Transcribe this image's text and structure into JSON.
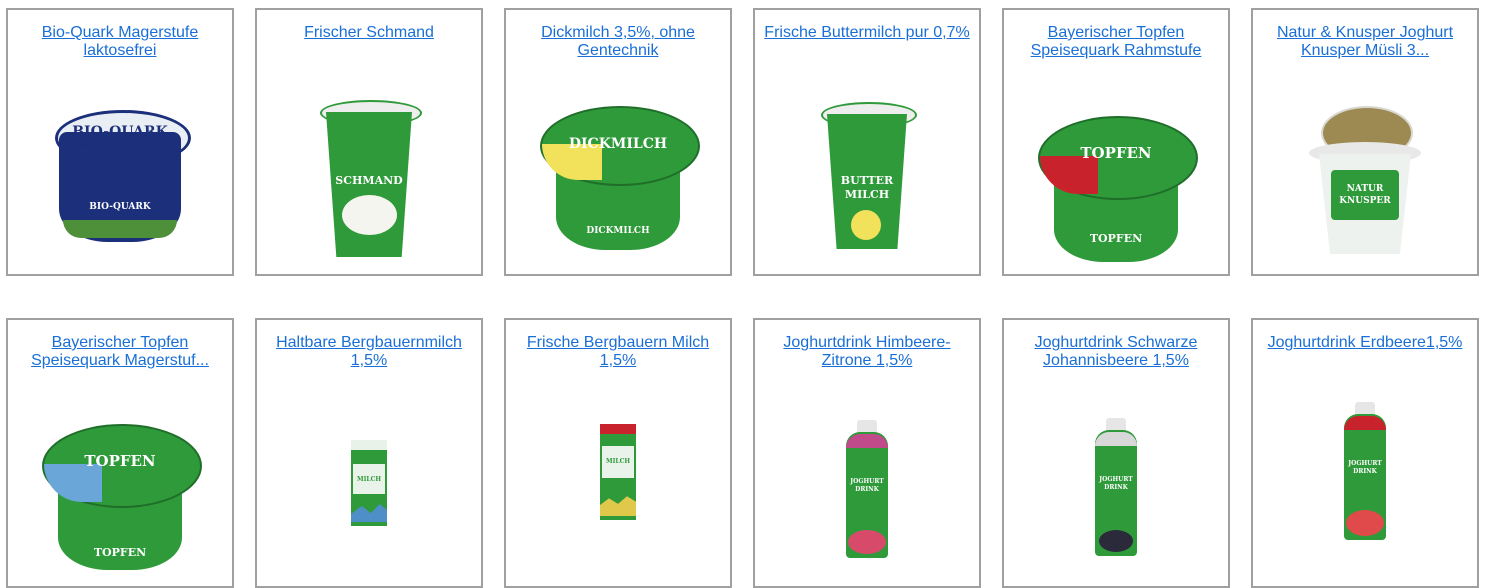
{
  "products": [
    {
      "title": "Bio-Quark Magerstufe laktosefrei",
      "img": "bio-quark-tub"
    },
    {
      "title": "Frischer Schmand",
      "img": "schmand-cup"
    },
    {
      "title": "Dickmilch 3,5%, ohne Gentechnik",
      "img": "dickmilch-tub"
    },
    {
      "title": "Frische Buttermilch pur 0,7%",
      "img": "buttermilch-cup"
    },
    {
      "title": "Bayerischer Topfen Speisequark Rahmstufe",
      "img": "topfen-tub-red"
    },
    {
      "title": "Natur & Knusper Joghurt Knusper Müsli 3...",
      "img": "knusper-cup"
    },
    {
      "title": "Bayerischer Topfen Speisequark Magerstuf...",
      "img": "topfen-tub-blue"
    },
    {
      "title": "Haltbare Bergbauernmilch 1,5%",
      "img": "milk-carton"
    },
    {
      "title": "Frische Bergbauern Milch 1,5%",
      "img": "milk-carton-fresh"
    },
    {
      "title": "Joghurtdrink Himbeere-Zitrone 1,5%",
      "img": "drink-bottle-raspberry"
    },
    {
      "title": "Joghurtdrink Schwarze Johannisbeere 1,5%",
      "img": "drink-bottle-currant"
    },
    {
      "title": "Joghurtdrink Erdbeere1,5%",
      "img": "drink-bottle-strawberry"
    }
  ],
  "labels": {
    "bio_quark": "BIO-QUARK",
    "bio_quark_sub": "Bayerischer Topfen",
    "schmand": "SCHMAND",
    "dickmilch": "DICKMILCH",
    "butter": "BUTTER",
    "milch": "MILCH",
    "topfen": "TOPFEN",
    "natur": "NATUR",
    "knusper": "KNUSPER",
    "joghurt": "JOGHURT",
    "drink": "DRINK"
  },
  "colors": {
    "link": "#1a6fd6",
    "border": "#a0a0a0",
    "green": "#2f9a3a",
    "dark_green": "#1f6e2a",
    "navy": "#1c2f7a",
    "red": "#c8232c",
    "blue_lid": "#6aa6d8",
    "yellow": "#f2e15a"
  }
}
